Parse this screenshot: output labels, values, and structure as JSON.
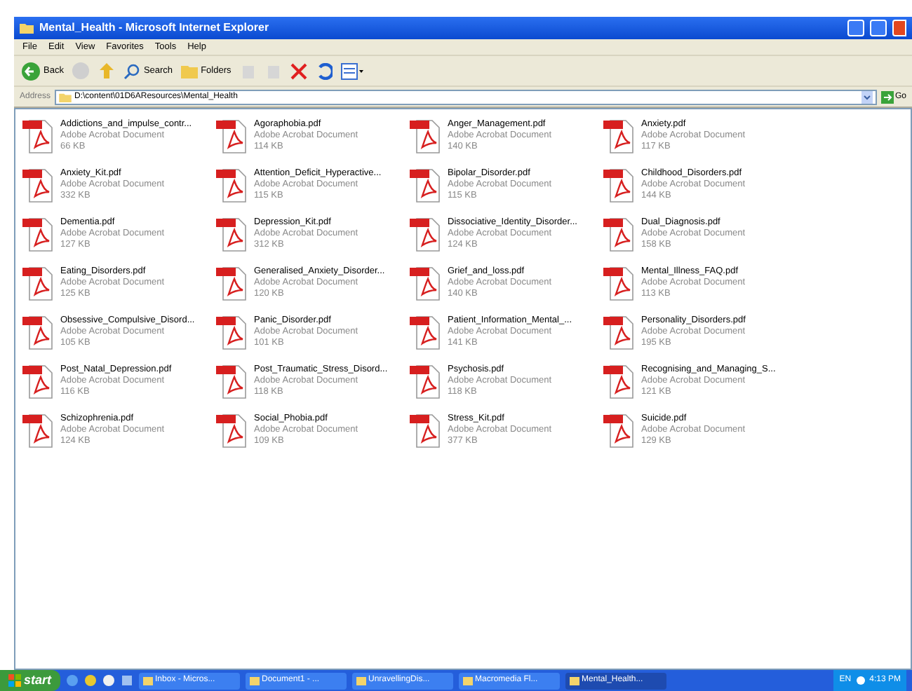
{
  "window": {
    "title": "Mental_Health - Microsoft Internet Explorer"
  },
  "menu": [
    "File",
    "Edit",
    "View",
    "Favorites",
    "Tools",
    "Help"
  ],
  "toolbar": {
    "back": "Back",
    "search": "Search",
    "folders": "Folders"
  },
  "address": {
    "label": "Address",
    "value": "D:\\content\\01D6AResources\\Mental_Health",
    "go": "Go"
  },
  "files": [
    {
      "name": "Addictions_and_impulse_contr...",
      "type": "Adobe Acrobat Document",
      "size": "66 KB"
    },
    {
      "name": "Agoraphobia.pdf",
      "type": "Adobe Acrobat Document",
      "size": "114 KB"
    },
    {
      "name": "Anger_Management.pdf",
      "type": "Adobe Acrobat Document",
      "size": "140 KB"
    },
    {
      "name": "Anxiety.pdf",
      "type": "Adobe Acrobat Document",
      "size": "117 KB"
    },
    {
      "name": "Anxiety_Kit.pdf",
      "type": "Adobe Acrobat Document",
      "size": "332 KB"
    },
    {
      "name": "Attention_Deficit_Hyperactive...",
      "type": "Adobe Acrobat Document",
      "size": "115 KB"
    },
    {
      "name": "Bipolar_Disorder.pdf",
      "type": "Adobe Acrobat Document",
      "size": "115 KB"
    },
    {
      "name": "Childhood_Disorders.pdf",
      "type": "Adobe Acrobat Document",
      "size": "144 KB"
    },
    {
      "name": "Dementia.pdf",
      "type": "Adobe Acrobat Document",
      "size": "127 KB"
    },
    {
      "name": "Depression_Kit.pdf",
      "type": "Adobe Acrobat Document",
      "size": "312 KB"
    },
    {
      "name": "Dissociative_Identity_Disorder...",
      "type": "Adobe Acrobat Document",
      "size": "124 KB"
    },
    {
      "name": "Dual_Diagnosis.pdf",
      "type": "Adobe Acrobat Document",
      "size": "158 KB"
    },
    {
      "name": "Eating_Disorders.pdf",
      "type": "Adobe Acrobat Document",
      "size": "125 KB"
    },
    {
      "name": "Generalised_Anxiety_Disorder...",
      "type": "Adobe Acrobat Document",
      "size": "120 KB"
    },
    {
      "name": "Grief_and_loss.pdf",
      "type": "Adobe Acrobat Document",
      "size": "140 KB"
    },
    {
      "name": "Mental_Illness_FAQ.pdf",
      "type": "Adobe Acrobat Document",
      "size": "113 KB"
    },
    {
      "name": "Obsessive_Compulsive_Disord...",
      "type": "Adobe Acrobat Document",
      "size": "105 KB"
    },
    {
      "name": "Panic_Disorder.pdf",
      "type": "Adobe Acrobat Document",
      "size": "101 KB"
    },
    {
      "name": "Patient_Information_Mental_...",
      "type": "Adobe Acrobat Document",
      "size": "141 KB"
    },
    {
      "name": "Personality_Disorders.pdf",
      "type": "Adobe Acrobat Document",
      "size": "195 KB"
    },
    {
      "name": "Post_Natal_Depression.pdf",
      "type": "Adobe Acrobat Document",
      "size": "116 KB"
    },
    {
      "name": "Post_Traumatic_Stress_Disord...",
      "type": "Adobe Acrobat Document",
      "size": "118 KB"
    },
    {
      "name": "Psychosis.pdf",
      "type": "Adobe Acrobat Document",
      "size": "118 KB"
    },
    {
      "name": "Recognising_and_Managing_S...",
      "type": "Adobe Acrobat Document",
      "size": "121 KB"
    },
    {
      "name": "Schizophrenia.pdf",
      "type": "Adobe Acrobat Document",
      "size": "124 KB"
    },
    {
      "name": "Social_Phobia.pdf",
      "type": "Adobe Acrobat Document",
      "size": "109 KB"
    },
    {
      "name": "Stress_Kit.pdf",
      "type": "Adobe Acrobat Document",
      "size": "377 KB"
    },
    {
      "name": "Suicide.pdf",
      "type": "Adobe Acrobat Document",
      "size": "129 KB"
    }
  ],
  "taskbar": {
    "start": "start",
    "tasks": [
      {
        "label": "Inbox - Micros...",
        "selected": false
      },
      {
        "label": "Document1 - ...",
        "selected": false
      },
      {
        "label": "UnravellingDis...",
        "selected": false
      },
      {
        "label": "Macromedia Fl...",
        "selected": false
      },
      {
        "label": "Mental_Health...",
        "selected": true
      }
    ],
    "language": "EN",
    "clock": "4:13 PM"
  }
}
